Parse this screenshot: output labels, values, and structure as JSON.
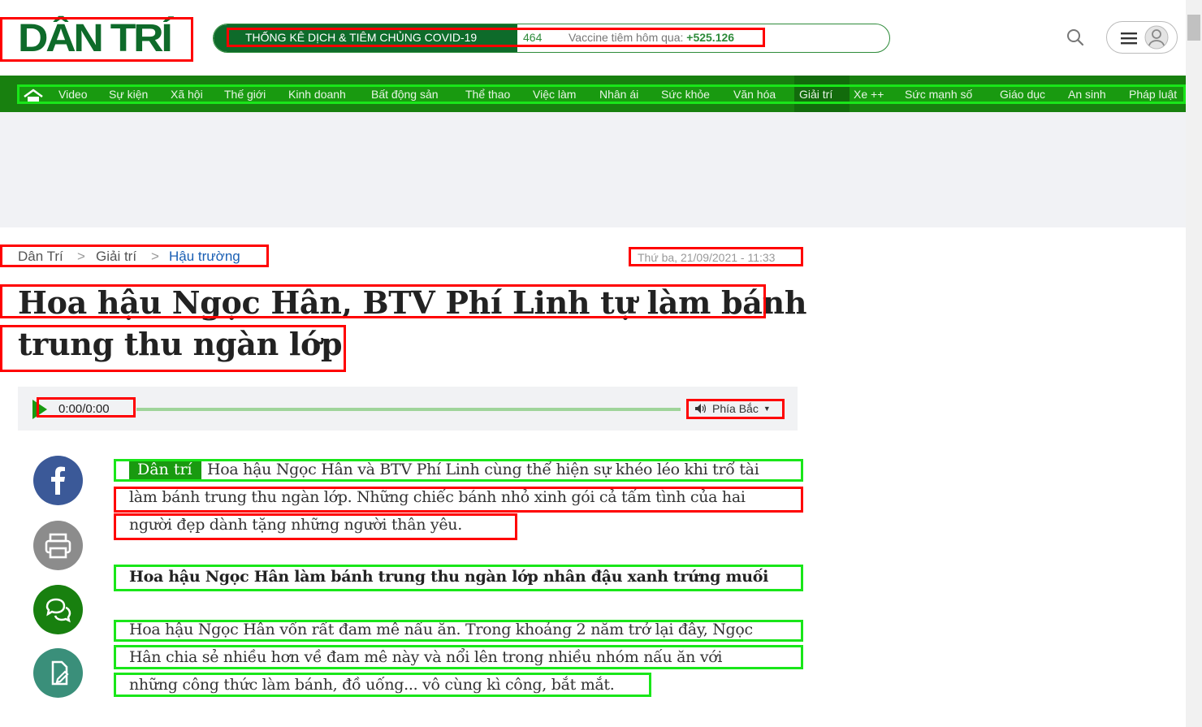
{
  "header": {
    "logo_text": "DÂN TRÍ",
    "covid": {
      "title": "THỐNG KÊ DỊCH & TIÊM CHỦNG COVID-19",
      "count": "464",
      "vaccine_label": "Vaccine tiêm hôm qua: ",
      "vaccine_value": "+525.126"
    },
    "icons": {
      "search": "search-icon",
      "menu": "hamburger-icon",
      "user": "user-icon"
    }
  },
  "nav": {
    "home_icon": "home-icon",
    "items": [
      "Video",
      "Sự kiện",
      "Xã hội",
      "Thế giới",
      "Kinh doanh",
      "Bất động sản",
      "Thể thao",
      "Việc làm",
      "Nhân ái",
      "Sức khỏe",
      "Văn hóa",
      "Giải trí",
      "Xe ++",
      "Sức mạnh số",
      "Giáo dục",
      "An sinh",
      "Pháp luật"
    ],
    "active": "Giải trí"
  },
  "breadcrumb": [
    "Dân Trí",
    "Giải trí",
    "Hậu trường"
  ],
  "date": "Thứ ba, 21/09/2021 - 11:33",
  "title_lines": [
    "Hoa hậu Ngọc Hân, BTV Phí Linh tự làm bánh",
    "trung thu ngàn lớp"
  ],
  "audio": {
    "time": "0:00/0:00",
    "voice": "Phía Bắc"
  },
  "share": [
    "facebook-icon",
    "print-icon",
    "comment-icon",
    "edit-icon"
  ],
  "article": {
    "tag": "Dân trí",
    "lead_lines": [
      "Hoa hậu Ngọc Hân và BTV Phí Linh cùng thể hiện sự khéo léo khi trổ tài",
      "làm bánh trung thu ngàn lớp. Những chiếc bánh nhỏ xinh gói cả tấm tình của hai",
      "người đẹp dành tặng những người thân yêu."
    ],
    "subhead": "Hoa hậu Ngọc Hân làm bánh trung thu ngàn lớp nhân đậu xanh trứng muối",
    "body_lines": [
      "Hoa hậu Ngọc Hân vốn rất đam mê nấu ăn. Trong khoảng 2 năm trở lại đây, Ngọc",
      "Hân chia sẻ nhiều hơn về đam mê này và nổi lên trong nhiều nhóm nấu ăn với",
      "những công thức làm bánh, đồ uống... vô cùng kì công, bắt mắt."
    ]
  },
  "colors": {
    "brand_green": "#18800f",
    "nav_green": "#199a10",
    "link_blue": "#1a5fb4"
  }
}
